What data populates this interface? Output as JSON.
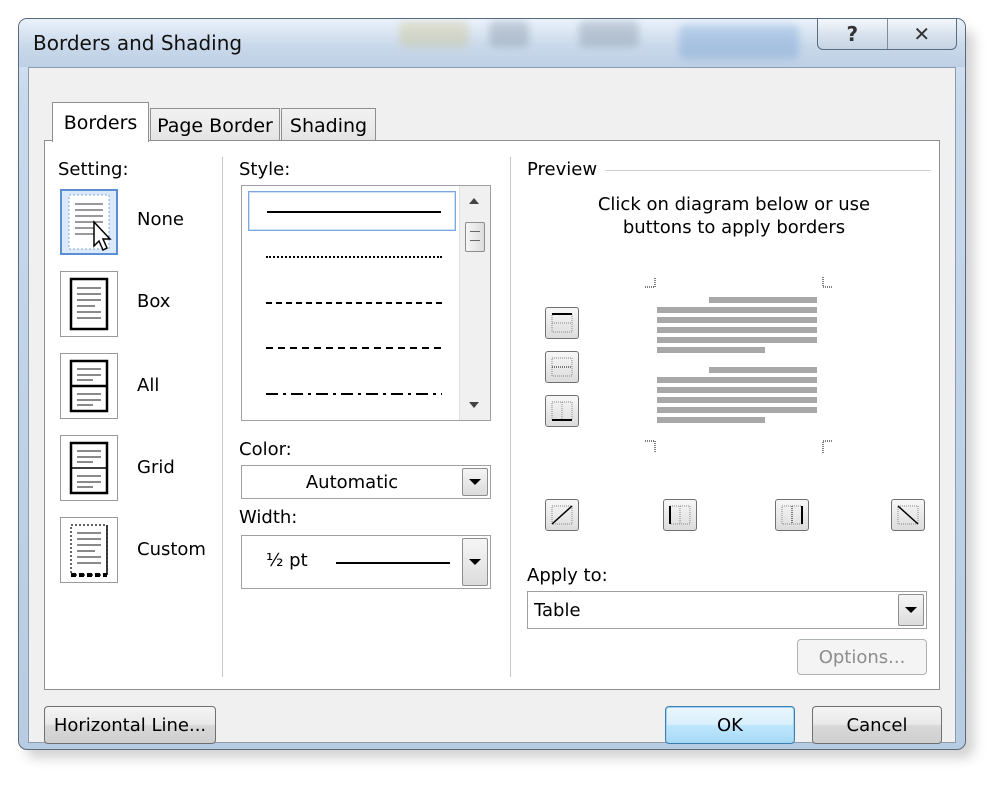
{
  "dialog": {
    "title": "Borders and Shading",
    "help_glyph": "?",
    "close_glyph": "✕"
  },
  "tabs": [
    {
      "label": "Borders",
      "active": true
    },
    {
      "label": "Page Border",
      "active": false
    },
    {
      "label": "Shading",
      "active": false
    }
  ],
  "setting": {
    "label": "Setting:",
    "items": [
      {
        "label": "None",
        "icon": "setting-none-icon",
        "selected": true
      },
      {
        "label": "Box",
        "icon": "setting-box-icon",
        "selected": false
      },
      {
        "label": "All",
        "icon": "setting-all-icon",
        "selected": false
      },
      {
        "label": "Grid",
        "icon": "setting-grid-icon",
        "selected": false
      },
      {
        "label": "Custom",
        "icon": "setting-custom-icon",
        "selected": false
      }
    ]
  },
  "style": {
    "label": "Style:",
    "items": [
      "solid",
      "dotted",
      "dashed-small",
      "dashed",
      "dash-dot"
    ],
    "selected_index": 0
  },
  "color": {
    "label": "Color:",
    "value": "Automatic"
  },
  "width": {
    "label": "Width:",
    "value": "½ pt"
  },
  "preview": {
    "label": "Preview",
    "instructions_line1": "Click on diagram below or use",
    "instructions_line2": "buttons to apply borders"
  },
  "apply_to": {
    "label": "Apply to:",
    "value": "Table"
  },
  "buttons": {
    "options": "Options...",
    "horizontal_line": "Horizontal Line...",
    "ok": "OK",
    "cancel": "Cancel"
  },
  "colors": {
    "selection": "#5b8fd4",
    "default_button": "#3c7fb1",
    "preview_text_lines": "#a8a8a8"
  }
}
